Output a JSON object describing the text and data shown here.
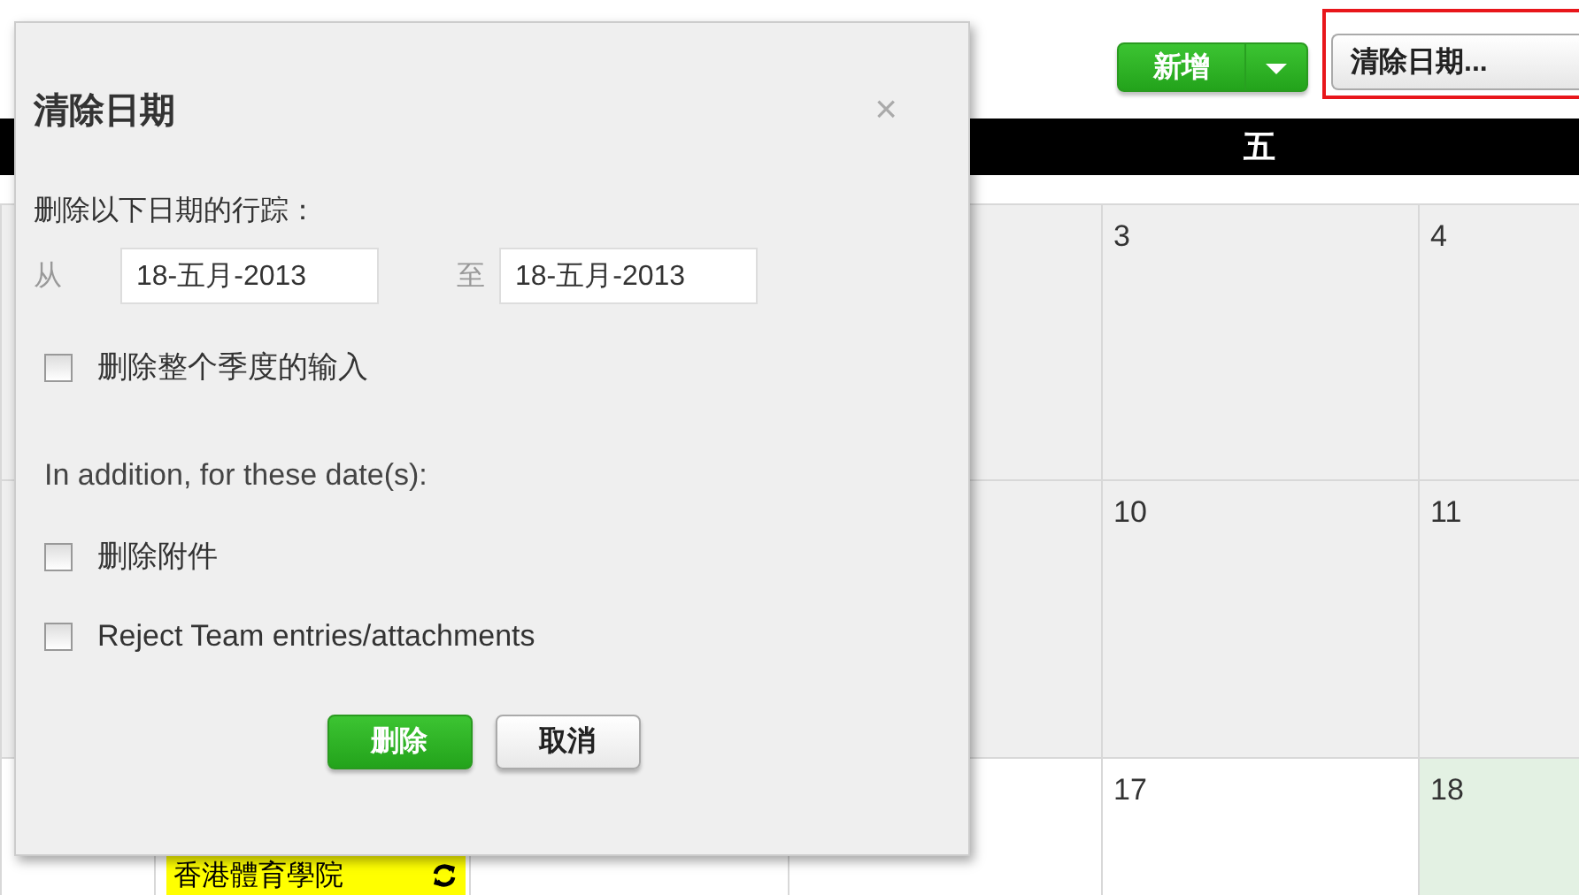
{
  "toolbar": {
    "add_button": "新增",
    "clear_button": "清除日期...",
    "clear_highlighted": true
  },
  "calendar": {
    "header_labels": [
      "五"
    ],
    "weeks": [
      {
        "shaded": true,
        "cells": [
          {},
          {},
          {},
          {},
          {
            "day": "3",
            "today": false
          },
          {
            "day": "4",
            "today": false
          }
        ]
      },
      {
        "shaded": true,
        "cells": [
          {},
          {},
          {},
          {},
          {
            "day": "10",
            "today": false
          },
          {
            "day": "11",
            "today": false
          }
        ]
      },
      {
        "shaded": false,
        "cells": [
          {},
          {
            "event": "香港體育學院"
          },
          {},
          {},
          {
            "day": "17",
            "today": false
          },
          {
            "day": "18",
            "today": true
          }
        ]
      }
    ]
  },
  "dialog": {
    "title": "清除日期",
    "close": "×",
    "intro": "删除以下日期的行踪：",
    "from_label": "从",
    "from_value": "18-五月-2013",
    "to_label": "至",
    "to_value": "18-五月-2013",
    "options": [
      {
        "kind": "checkbox",
        "label": "删除整个季度的输入",
        "checked": false
      },
      {
        "kind": "heading",
        "label": "In addition, for these date(s):"
      },
      {
        "kind": "checkbox",
        "label": "删除附件",
        "checked": false
      },
      {
        "kind": "checkbox",
        "label": "Reject Team entries/attachments",
        "checked": false
      }
    ],
    "buttons": [
      {
        "kind": "primary",
        "label": "删除"
      },
      {
        "kind": "secondary",
        "label": "取消"
      }
    ]
  }
}
